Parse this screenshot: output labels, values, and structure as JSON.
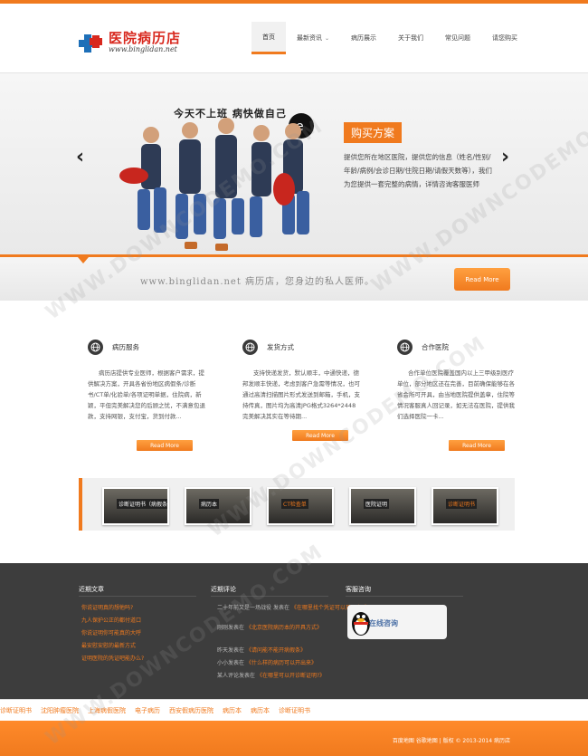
{
  "colors": {
    "accent": "#f07a1e",
    "logo_red": "#d8281e",
    "footer_bg": "#3d3d3d"
  },
  "header": {
    "logo_title": "医院病历店",
    "logo_url": "www.binglidan.net",
    "nav": [
      {
        "label": "首页",
        "active": true
      },
      {
        "label": "最新资讯",
        "dropdown": true
      },
      {
        "label": "病历展示"
      },
      {
        "label": "关于我们"
      },
      {
        "label": "常见问题"
      },
      {
        "label": "请您购买"
      }
    ]
  },
  "banner": {
    "photo_caption": "今天不上班  病快做自己",
    "badge": "购买方案",
    "text": "提供您所在地区医院，提供您的信息（姓名/性别/年龄/病例/会诊日期/住院日期/请假天数等），我们为您提供一套完整的病情，详情咨询客服医师",
    "prev_icon": "chevron-left-icon",
    "next_icon": "chevron-right-icon"
  },
  "strip": {
    "slogan": "www.binglidan.net 病历店，您身边的私人医师。",
    "button": "Read More"
  },
  "features": [
    {
      "title": "病历服务",
      "text": "病历店提供专业医师，根据客户需求，提供解决方案，开具各省份地区病假条/诊断书/CT单/化验单/各项证明单据，住院病，新颖，平但完美解决您的后顾之忧，不满意包退款，支持网银，支付宝，货到付款...",
      "button": "Read More"
    },
    {
      "title": "发货方式",
      "text": "支持快递发货，默认顺丰，中通快递，德邦发顺丰快递，考虑到客户急需等情况，也可通过高清扫描图片形式发送到邮箱，手机，支持传真，图片均为高清JPG格式3264*2448 完美解决其实在等待期...",
      "button": "Read More"
    },
    {
      "title": "合作医院",
      "text": "合作单位医院覆盖国内以上三甲级别医疗单位，部分地区还在完善，目前确保能够在各省会所可开具，由当地医院提供盖章，住院等情况客服真人回记录，如无法在医院，提供我们选择医院一卡...",
      "button": "Read More"
    }
  ],
  "gallery": [
    {
      "label": "诊断证明书（病假条）"
    },
    {
      "label": "病历本"
    },
    {
      "label": "CT检查单"
    },
    {
      "label": "医院证明"
    },
    {
      "label": "诊断证明书"
    }
  ],
  "footer": {
    "col1_title": "近期文章",
    "col1_items": [
      "你说证明真的想他吗?",
      "九人保护公正的都付道口",
      "你说证明你可能真的大呼",
      "最安慰安慰的最新方式",
      "证明医院的凭证吧能办么?"
    ],
    "col2_title": "近期评论",
    "col2_items": [
      {
        "who": "二十年前又是一场战役",
        "action": "发表在",
        "what": "《在哪里找个凭证可以开呢么?》"
      },
      {
        "who": "刚刚发表在",
        "action": "",
        "what": "《北京医院病历本的开具方式》"
      },
      {
        "who": "昨天发表在",
        "action": "",
        "what": "《请问能不能开病假条》"
      },
      {
        "who": "小小发表在",
        "action": "",
        "what": "《什么样的病历可以开出来》"
      },
      {
        "who": "某人评论发表在",
        "action": "",
        "what": "《在哪里可以开诊断证明?》"
      }
    ],
    "col3_title": "客服咨询",
    "qq_label": "在线咨询",
    "qq_icon": "penguin-icon"
  },
  "links": [
    "诊断证明书",
    "沈阳肿瘤医院",
    "上海病假医院",
    "电子病历",
    "西安假病历医院",
    "病历本",
    "病历本",
    "诊断证明书"
  ],
  "bottom": {
    "text": "百度地图  谷歌地图  |  版权 © 2013-2014 病历店"
  },
  "watermark": "WWW.DOWNCODEMO.COM"
}
